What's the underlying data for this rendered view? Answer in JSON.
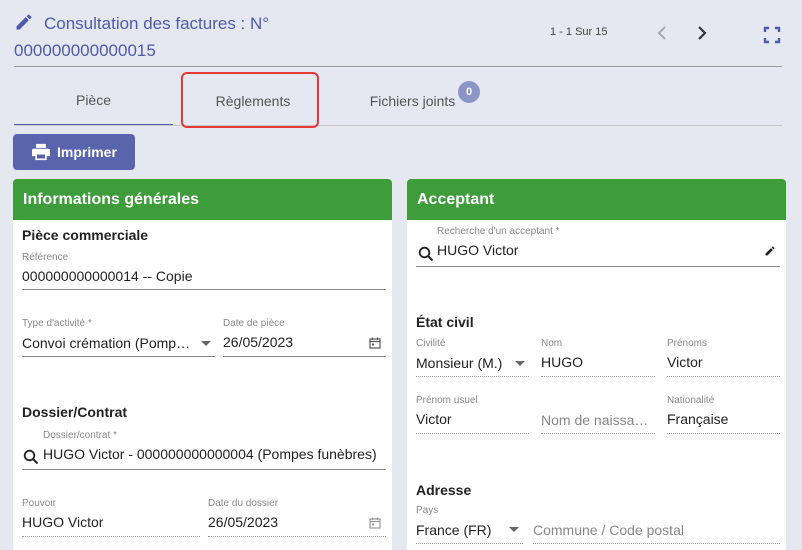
{
  "header": {
    "title": "Consultation des factures : N° 000000000000015",
    "pager": "1 - 1 Sur 15"
  },
  "tabs": [
    {
      "label": "Pièce"
    },
    {
      "label": "Règlements"
    },
    {
      "label": "Fichiers joints",
      "badge": "0"
    }
  ],
  "toolbar": {
    "print_label": "Imprimer"
  },
  "general": {
    "title": "Informations générales",
    "piece_section": "Pièce commerciale",
    "reference": {
      "label": "Référence",
      "value": "000000000000014 -- Copie"
    },
    "activity_type": {
      "label": "Type d'activité *",
      "value": "Convoi crémation (Pompes funèbres)"
    },
    "piece_date": {
      "label": "Date de pièce",
      "value": "26/05/2023"
    },
    "dossier_section": "Dossier/Contrat",
    "dossier": {
      "label": "Dossier/contrat *",
      "value": "HUGO Victor - 000000000000004 (Pompes funèbres)"
    },
    "pouvoir": {
      "label": "Pouvoir",
      "value": "HUGO Victor"
    },
    "dossier_date": {
      "label": "Date du dossier",
      "value": "26/05/2023"
    }
  },
  "acceptant": {
    "title": "Acceptant",
    "search": {
      "label": "Recherche d'un acceptant *",
      "value": "HUGO Victor"
    },
    "civil_section": "État civil",
    "civilite": {
      "label": "Civilité",
      "value": "Monsieur (M.)"
    },
    "nom": {
      "label": "Nom",
      "value": "HUGO"
    },
    "prenoms": {
      "label": "Prénoms",
      "value": "Victor"
    },
    "prenom_usuel": {
      "label": "Prénom usuel",
      "value": "Victor"
    },
    "nom_naissance": {
      "placeholder": "Nom de naissance"
    },
    "nationalite": {
      "label": "Nationalité",
      "value": "Française"
    },
    "address_section": "Adresse",
    "pays": {
      "label": "Pays",
      "value": "France (FR)"
    },
    "commune": {
      "placeholder": "Commune / Code postal"
    }
  },
  "colors": {
    "accent": "#5a64ac",
    "card_header": "#3f9c3a",
    "highlight": "#e53935"
  }
}
